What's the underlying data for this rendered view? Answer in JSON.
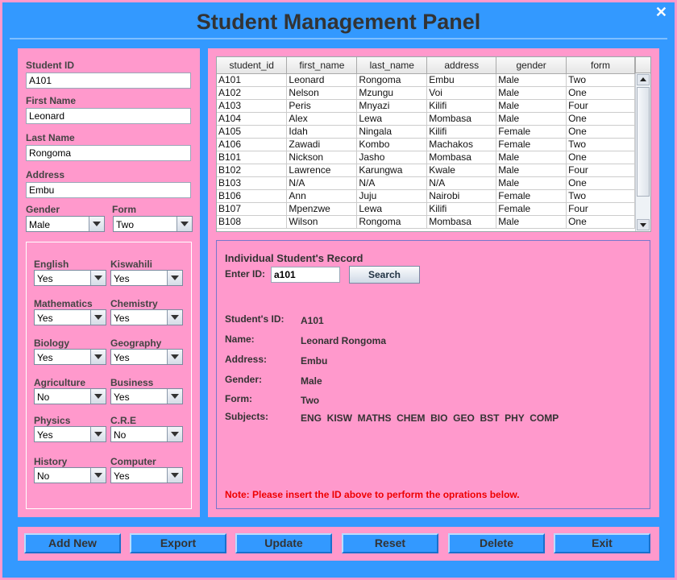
{
  "window": {
    "title": "Student Management Panel",
    "close_glyph": "✕"
  },
  "form": {
    "student_id": {
      "label": "Student ID",
      "value": "A101"
    },
    "first_name": {
      "label": "First Name",
      "value": "Leonard"
    },
    "last_name": {
      "label": "Last Name",
      "value": "Rongoma"
    },
    "address": {
      "label": "Address",
      "value": "Embu"
    },
    "gender": {
      "label": "Gender",
      "value": "Male"
    },
    "form_level": {
      "label": "Form",
      "value": "Two"
    }
  },
  "subjects": [
    {
      "label": "English",
      "value": "Yes"
    },
    {
      "label": "Kiswahili",
      "value": "Yes"
    },
    {
      "label": "Mathematics",
      "value": "Yes"
    },
    {
      "label": "Chemistry",
      "value": "Yes"
    },
    {
      "label": "Biology",
      "value": "Yes"
    },
    {
      "label": "Geography",
      "value": "Yes"
    },
    {
      "label": "Agriculture",
      "value": "No"
    },
    {
      "label": "Business",
      "value": "Yes"
    },
    {
      "label": "Physics",
      "value": "Yes"
    },
    {
      "label": "C.R.E",
      "value": "No"
    },
    {
      "label": "History",
      "value": "No"
    },
    {
      "label": "Computer",
      "value": "Yes"
    }
  ],
  "table": {
    "columns": [
      "student_id",
      "first_name",
      "last_name",
      "address",
      "gender",
      "form"
    ],
    "rows": [
      [
        "A101",
        "Leonard",
        "Rongoma",
        "Embu",
        "Male",
        "Two"
      ],
      [
        "A102",
        "Nelson",
        "Mzungu",
        "Voi",
        "Male",
        "One"
      ],
      [
        "A103",
        "Peris",
        "Mnyazi",
        "Kilifi",
        "Male",
        "Four"
      ],
      [
        "A104",
        "Alex",
        "Lewa",
        "Mombasa",
        "Male",
        "One"
      ],
      [
        "A105",
        "Idah",
        "Ningala",
        "Kilifi",
        "Female",
        "One"
      ],
      [
        "A106",
        "Zawadi",
        "Kombo",
        "Machakos",
        "Female",
        "Two"
      ],
      [
        "B101",
        "Nickson",
        "Jasho",
        "Mombasa",
        "Male",
        "One"
      ],
      [
        "B102",
        "Lawrence",
        "Karungwa",
        "Kwale",
        "Male",
        "Four"
      ],
      [
        "B103",
        "N/A",
        "N/A",
        "N/A",
        "Male",
        "One"
      ],
      [
        "B106",
        "Ann",
        "Juju",
        "Nairobi",
        "Female",
        "Two"
      ],
      [
        "B107",
        "Mpenzwe",
        "Lewa",
        "Kilifi",
        "Female",
        "Four"
      ],
      [
        "B108",
        "Wilson",
        "Rongoma",
        "Mombasa",
        "Male",
        "One"
      ]
    ]
  },
  "record": {
    "title": "Individual Student's Record",
    "enter_id_label": "Enter ID:",
    "enter_id_value": "a101",
    "search_label": "Search",
    "fields": [
      {
        "label": "Student's ID:",
        "value": "A101"
      },
      {
        "label": "Name:",
        "value": "Leonard Rongoma"
      },
      {
        "label": "Address:",
        "value": "Embu"
      },
      {
        "label": "Gender:",
        "value": "Male"
      },
      {
        "label": "Form:",
        "value": "Two"
      },
      {
        "label": "Subjects:",
        "value": "ENG  KISW  MATHS  CHEM  BIO  GEO  BST  PHY  COMP"
      }
    ],
    "note": "Note: Please insert the ID above to perform the oprations below."
  },
  "actions": [
    "Add New",
    "Export",
    "Update",
    "Reset",
    "Delete",
    "Exit"
  ],
  "colors": {
    "background": "#3399ff",
    "panel": "#ff99cc",
    "note": "#ee0000"
  }
}
